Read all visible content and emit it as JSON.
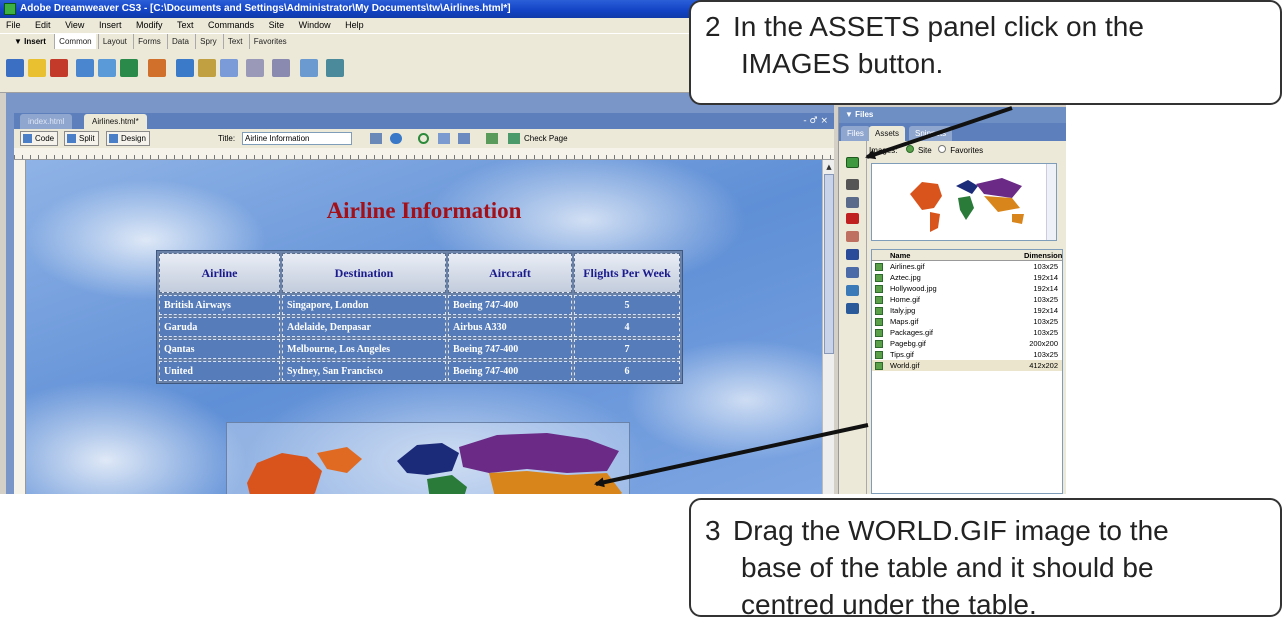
{
  "window": {
    "title": "Adobe Dreamweaver CS3 - [C:\\Documents and Settings\\Administrator\\My Documents\\tw\\Airlines.html*]"
  },
  "menu": [
    "File",
    "Edit",
    "View",
    "Insert",
    "Modify",
    "Text",
    "Commands",
    "Site",
    "Window",
    "Help"
  ],
  "insert_bar": {
    "label": "▼ Insert",
    "tabs": [
      "Common",
      "Layout",
      "Forms",
      "Data",
      "Spry",
      "Text",
      "Favorites"
    ]
  },
  "document": {
    "tabs": [
      "index.html",
      "Airlines.html*"
    ],
    "view_buttons": [
      "Code",
      "Split",
      "Design"
    ],
    "title_label": "Title:",
    "title_value": "Airline Information",
    "check_page": "Check Page",
    "window_controls": "- ♂ ×"
  },
  "page": {
    "heading": "Airline Information",
    "table_headers": [
      "Airline",
      "Destination",
      "Aircraft",
      "Flights Per Week"
    ],
    "rows": [
      [
        "British Airways",
        "Singapore, London",
        "Boeing 747-400",
        "5"
      ],
      [
        "Garuda",
        "Adelaide, Denpasar",
        "Airbus A330",
        "4"
      ],
      [
        "Qantas",
        "Melbourne, Los Angeles",
        "Boeing 747-400",
        "7"
      ],
      [
        "United",
        "Sydney, San Francisco",
        "Boeing 747-400",
        "6"
      ]
    ]
  },
  "files_panel": {
    "header": "▼ Files",
    "tabs": [
      "Files",
      "Assets",
      "Snippets"
    ],
    "images_label": "Images:",
    "scope_site": "Site",
    "scope_favorites": "Favorites",
    "col_name": "Name",
    "col_dimensions": "Dimensions",
    "assets": [
      {
        "name": "Airlines.gif",
        "dims": "103x25"
      },
      {
        "name": "Aztec.jpg",
        "dims": "192x14"
      },
      {
        "name": "Hollywood.jpg",
        "dims": "192x14"
      },
      {
        "name": "Home.gif",
        "dims": "103x25"
      },
      {
        "name": "Italy.jpg",
        "dims": "192x14"
      },
      {
        "name": "Maps.gif",
        "dims": "103x25"
      },
      {
        "name": "Packages.gif",
        "dims": "103x25"
      },
      {
        "name": "Pagebg.gif",
        "dims": "200x200"
      },
      {
        "name": "Tips.gif",
        "dims": "103x25"
      },
      {
        "name": "World.gif",
        "dims": "412x202"
      }
    ]
  },
  "callouts": {
    "step2": {
      "num": "2",
      "line1": "In the ASSETS panel click on the",
      "line2": "IMAGES button."
    },
    "step3": {
      "num": "3",
      "line1": "Drag the WORLD.GIF image to the",
      "line2": "base of the table and it should be",
      "line3": "centred under the table."
    }
  }
}
